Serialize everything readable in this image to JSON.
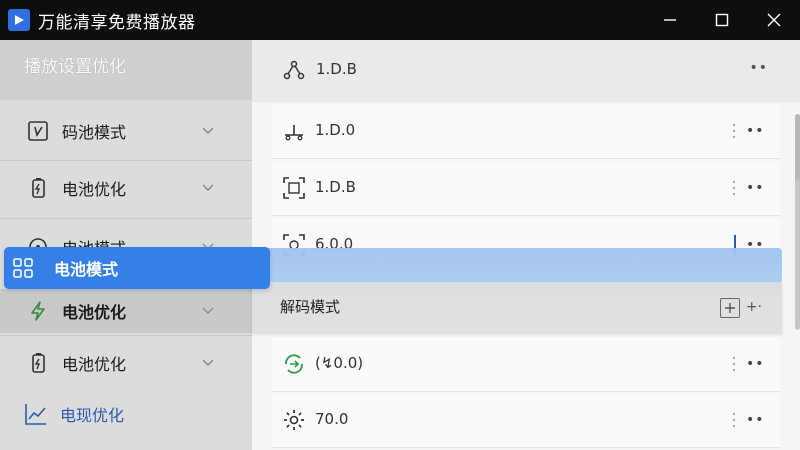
{
  "window": {
    "title": "万能清享免费播放器"
  },
  "sidebar": {
    "title": "播放设置优化",
    "items": [
      {
        "label": "码池模式",
        "icon": "video-frame-icon"
      },
      {
        "label": "电池优化",
        "icon": "battery-icon"
      },
      {
        "label": "电池模式",
        "icon": "circle-icon"
      },
      {
        "label": "电池优化",
        "icon": "lightning-icon"
      },
      {
        "label": "电池优化",
        "icon": "battery-icon"
      }
    ],
    "active": {
      "label": "电池模式",
      "icon": "grid-icon"
    },
    "bottom": {
      "label": "电现优化",
      "icon": "line-chart-icon"
    }
  },
  "main": {
    "header": {
      "value": "1.D.B"
    },
    "rows": [
      {
        "value": "1.D.0",
        "icon": "timeline-icon"
      },
      {
        "value": "1.D.B",
        "icon": "scan-frame-icon"
      },
      {
        "value": "6.0.0",
        "icon": "scan-refresh-icon"
      },
      {
        "value": "(↯0.0)",
        "icon": "green-sync-icon"
      },
      {
        "value": "70.0",
        "icon": "gear-icon"
      }
    ],
    "decode_mode": {
      "title": "解码模式",
      "more": "+·"
    }
  },
  "colors": {
    "accent": "#3580e6",
    "titlebar": "#0e0e10",
    "link": "#2a5cae"
  }
}
